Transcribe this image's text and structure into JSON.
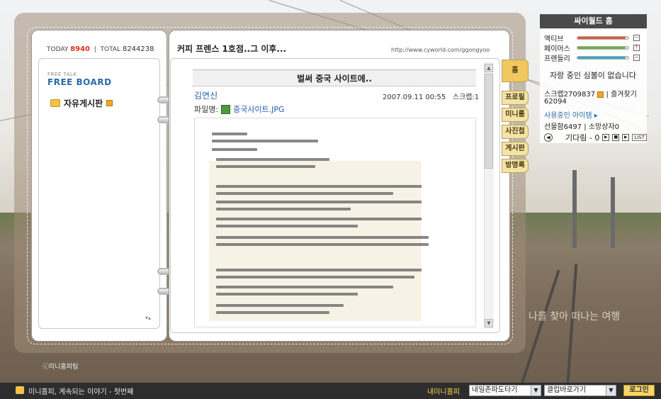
{
  "header": {
    "today_label": "TODAY",
    "today_count": "8940",
    "total_label": "TOTAL",
    "total_count": "8244238",
    "title": "커피 프렌스 1호점..그 이후...",
    "url": "http://www.cyworld.com/ggongyoo"
  },
  "left": {
    "free_talk": "FREE TALK",
    "board_title": "FREE BOARD",
    "folder": "자유게시판"
  },
  "post": {
    "title": "벌써 중국 사이트에..",
    "author": "김연신",
    "date": "2007.09.11 00:55",
    "scrap": "스크랩:1",
    "file_label": "파일명:",
    "file_name": "중국사이트.JPG"
  },
  "side_tabs": [
    "홈",
    "프로필",
    "미니룸",
    "사진첩",
    "게시판",
    "방명록"
  ],
  "panel": {
    "title": "싸이월드 홈",
    "stats": [
      {
        "label": "액티브",
        "color": "#e05a3a",
        "value": 0.95,
        "btn": "−"
      },
      {
        "label": "페이머스",
        "color": "#6bb33a",
        "value": 0.95,
        "btn": "↑"
      },
      {
        "label": "프렌들리",
        "color": "#3aa6c8",
        "value": 0.95,
        "btn": "−"
      }
    ],
    "mood": "자랑 중인 심볼이 없습니다",
    "scrap_text": "스크랩2709837",
    "scrap_fav": "| 즐겨찾기",
    "fav_count": "62094",
    "items_link": "사용중인 아이템 ▸",
    "gift": "선물함6497",
    "wish": "| 소망상자0",
    "player_text": "기다림 - 0",
    "list_btn": "LIST"
  },
  "watermark": "나를 찾아 떠나는 여행",
  "copyright": "ⓒ미니홈피팀",
  "bottom": {
    "message": "미니홈피, 계속되는 이야기 - 첫번째",
    "my_minihome": "내미니홈피",
    "select1": "내일촌파도타기",
    "select2": "클럽바로가기",
    "login": "로그인"
  }
}
